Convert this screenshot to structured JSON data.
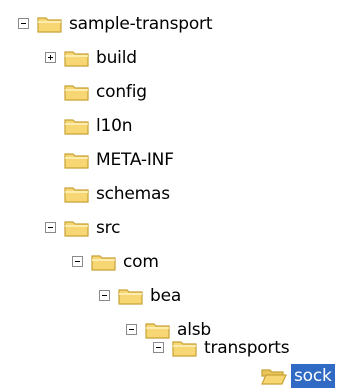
{
  "tree": {
    "nodes": [
      {
        "label": "sample-transport",
        "expander": "minus",
        "open": false,
        "selected": false
      },
      {
        "label": "build",
        "expander": "plus",
        "open": false,
        "selected": false
      },
      {
        "label": "config",
        "expander": "none",
        "open": false,
        "selected": false
      },
      {
        "label": "l10n",
        "expander": "none",
        "open": false,
        "selected": false
      },
      {
        "label": "META-INF",
        "expander": "none",
        "open": false,
        "selected": false
      },
      {
        "label": "schemas",
        "expander": "none",
        "open": false,
        "selected": false
      },
      {
        "label": "src",
        "expander": "minus",
        "open": false,
        "selected": false
      },
      {
        "label": "com",
        "expander": "minus",
        "open": false,
        "selected": false
      },
      {
        "label": "bea",
        "expander": "minus",
        "open": false,
        "selected": false
      },
      {
        "label": "alsb",
        "expander": "minus",
        "open": false,
        "selected": false
      },
      {
        "label": "transports",
        "expander": "minus",
        "open": false,
        "selected": false
      },
      {
        "label": "sock",
        "expander": "none",
        "open": true,
        "selected": true
      }
    ],
    "colors": {
      "folder_body": "#f7d774",
      "folder_outline": "#c8a234",
      "selection": "#316ac5",
      "expander_border": "#8a8a8a"
    }
  }
}
